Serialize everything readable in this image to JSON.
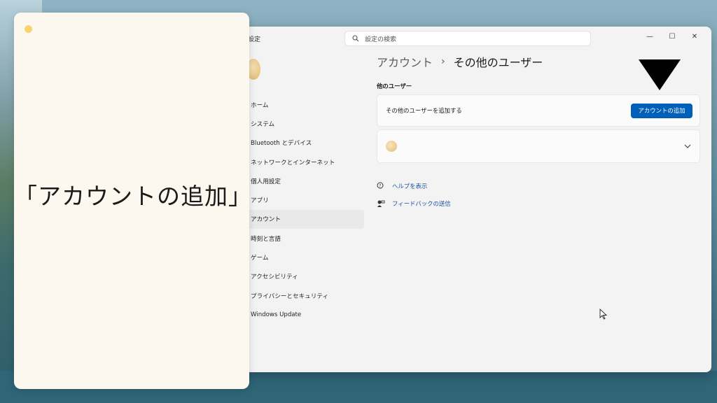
{
  "window": {
    "title": "設定",
    "search_placeholder": "設定の検索",
    "controls": {
      "minimize": "—",
      "maximize": "☐",
      "close": "✕"
    }
  },
  "nav": {
    "items": [
      {
        "label": "ホーム"
      },
      {
        "label": "システム"
      },
      {
        "label": "Bluetooth とデバイス"
      },
      {
        "label": "ネットワークとインターネット"
      },
      {
        "label": "個人用設定"
      },
      {
        "label": "アプリ"
      },
      {
        "label": "アカウント",
        "active": true
      },
      {
        "label": "時刻と言語"
      },
      {
        "label": "ゲーム"
      },
      {
        "label": "アクセシビリティ"
      },
      {
        "label": "プライバシーとセキュリティ"
      },
      {
        "label": "Windows Update"
      }
    ]
  },
  "content": {
    "breadcrumb": {
      "parent": "アカウント",
      "separator": "›",
      "current": "その他のユーザー"
    },
    "section_label": "他のユーザー",
    "add_card": {
      "text": "その他のユーザーを追加する",
      "button_label": "アカウントの追加"
    },
    "links": {
      "help": "ヘルプを表示",
      "feedback": "フィードバックの送信"
    }
  },
  "caption": {
    "text": "「アカウントの追加」"
  },
  "colors": {
    "accent": "#005fb8",
    "panel_bg": "#fdf8ef",
    "link": "#1a4fa0"
  }
}
